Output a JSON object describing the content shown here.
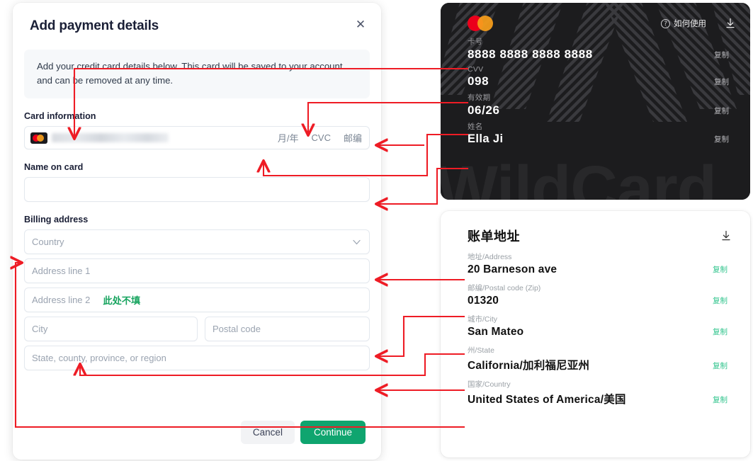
{
  "modal": {
    "title": "Add payment details",
    "close_icon": "close-icon",
    "info_text": "Add your credit card details below. This card will be saved to your account and can be removed at any time.",
    "card_information_label": "Card information",
    "card_number_value": "",
    "card_number_masked": true,
    "card_brand_icon": "mastercard-icon",
    "expiry_placeholder": "月/年",
    "cvc_placeholder": "CVC",
    "zip_placeholder": "邮编",
    "name_on_card_label": "Name on card",
    "name_on_card_value": "",
    "billing_address_label": "Billing address",
    "country_placeholder": "Country",
    "country_caret_icon": "chevron-down-icon",
    "address_line_1_placeholder": "Address line 1",
    "address_line_2_placeholder": "Address line 2",
    "address_line_2_note": "此处不填",
    "city_placeholder": "City",
    "postal_code_placeholder": "Postal code",
    "state_placeholder": "State, county, province, or region",
    "cancel_label": "Cancel",
    "continue_label": "Continue"
  },
  "virtual_card": {
    "brand_icon": "mastercard-icon",
    "howto_label": "如何使用",
    "howto_icon": "question-circle-icon",
    "download_icon": "download-icon",
    "watermark": "WildCard",
    "rows": [
      {
        "label": "卡号",
        "value": "8888 8888 8888 8888",
        "copy": "复制"
      },
      {
        "label": "CVV",
        "value": "098",
        "copy": "复制"
      },
      {
        "label": "有效期",
        "value": "06/26",
        "copy": "复制"
      },
      {
        "label": "姓名",
        "value": "Ella Ji",
        "copy": "复制"
      }
    ]
  },
  "billing_panel": {
    "title": "账单地址",
    "download_icon": "download-icon",
    "rows": [
      {
        "label": "地址/Address",
        "value": "20 Barneson ave",
        "copy": "复制"
      },
      {
        "label": "邮编/Postal code (Zip)",
        "value": "01320",
        "copy": "复制"
      },
      {
        "label": "城市/City",
        "value": "San Mateo",
        "copy": "复制"
      },
      {
        "label": "州/State",
        "value": "California/加利福尼亚州",
        "copy": "复制"
      },
      {
        "label": "国家/Country",
        "value": "United States of America/美国",
        "copy": "复制"
      }
    ]
  },
  "annotations": {
    "color": "#ee1c25",
    "description": "Red arrows mapping each WildCard value on the right to the matching form field on the left"
  },
  "colors": {
    "accent_green": "#0fa56f",
    "note_green": "#17a45f",
    "copy_green": "#31c48d",
    "card_dark": "#1c1c1e",
    "annotation_red": "#ee1c25",
    "mastercard_red": "#eb001b",
    "mastercard_orange": "#f79e1b"
  }
}
